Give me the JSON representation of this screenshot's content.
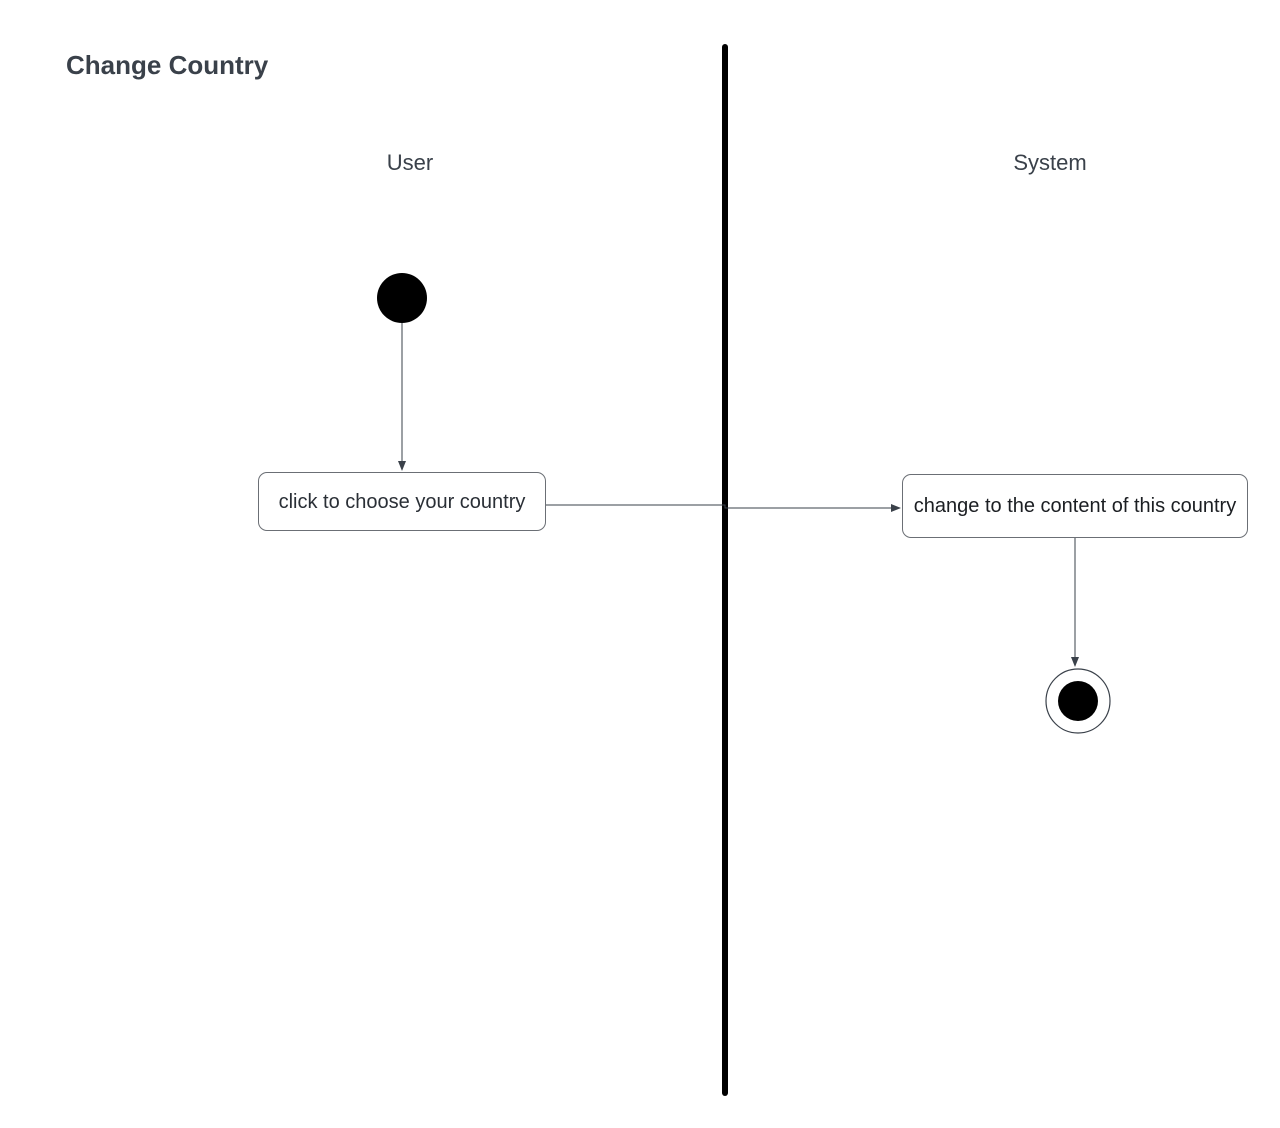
{
  "diagram": {
    "title": "Change Country",
    "lanes": [
      {
        "label": "User"
      },
      {
        "label": "System"
      }
    ],
    "nodes": {
      "start": {
        "type": "initial-node"
      },
      "choose_country": {
        "type": "action",
        "label": "click to choose your country"
      },
      "change_content": {
        "type": "action",
        "label": "change to the content of this country"
      },
      "end": {
        "type": "final-node"
      }
    },
    "edges": [
      {
        "from": "start",
        "to": "choose_country"
      },
      {
        "from": "choose_country",
        "to": "change_content"
      },
      {
        "from": "change_content",
        "to": "end"
      }
    ],
    "colors": {
      "node_fill": "#000000",
      "line": "#3a414a",
      "text": "#3a414a"
    }
  }
}
